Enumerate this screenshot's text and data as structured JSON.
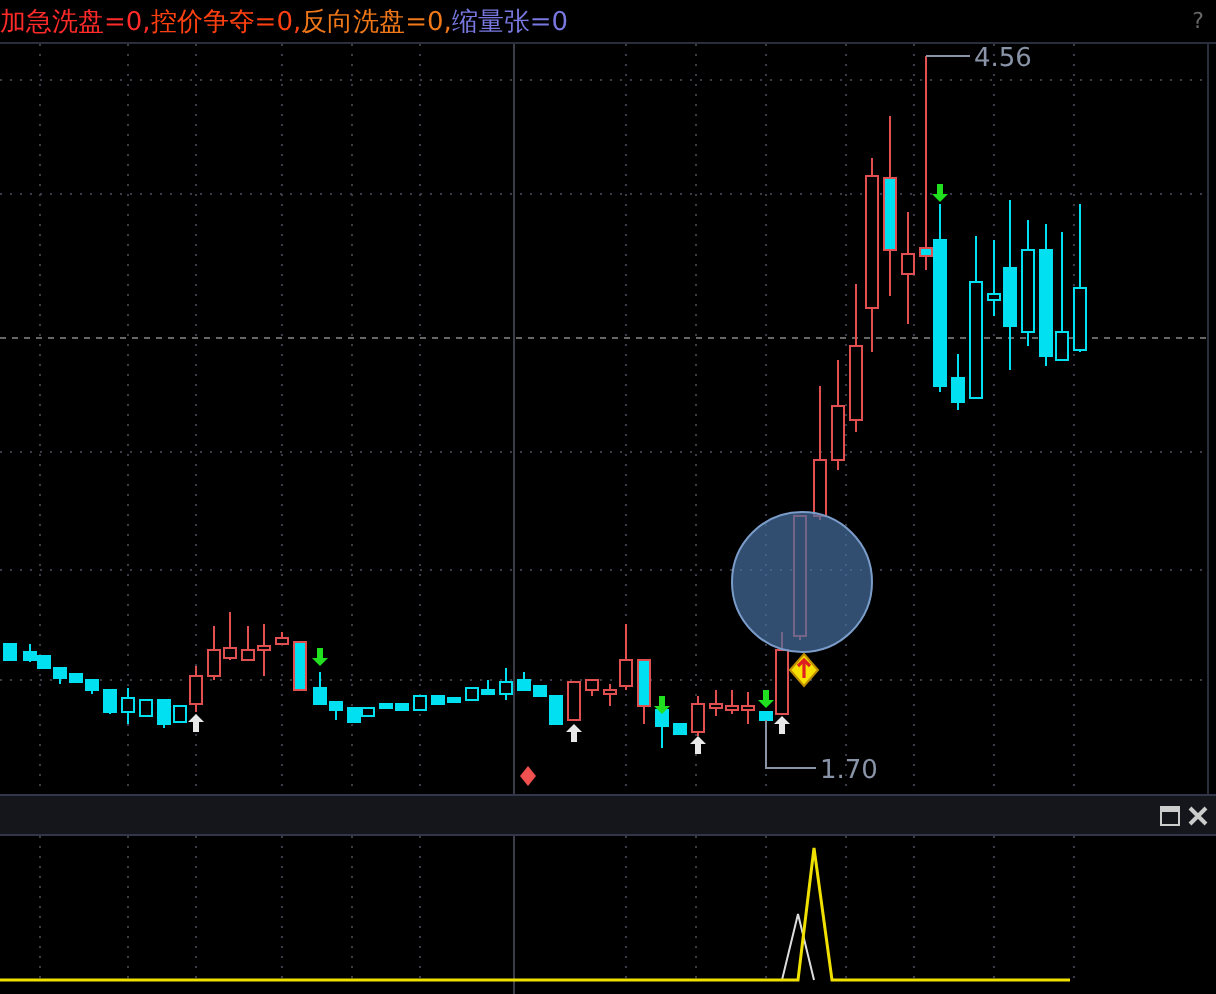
{
  "legend": [
    {
      "label": "加急洗盘=0,",
      "color": "#ff2a2a"
    },
    {
      "label": "控价争夺=0,",
      "color": "#ff4010"
    },
    {
      "label": "反向洗盘=0,",
      "color": "#f07818"
    },
    {
      "label": "缩量张=0",
      "color": "#7878e0"
    }
  ],
  "help": "?",
  "price_labels": {
    "high": "4.56",
    "low": "1.70"
  }
}
